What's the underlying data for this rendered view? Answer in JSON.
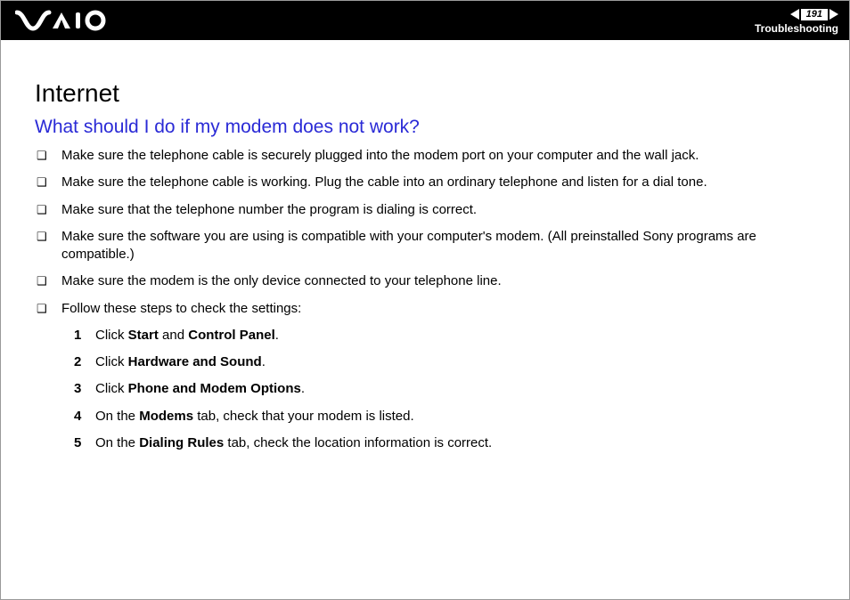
{
  "header": {
    "page_number": "191",
    "section_label": "Troubleshooting"
  },
  "content": {
    "section_title": "Internet",
    "question": "What should I do if my modem does not work?",
    "bullets": [
      "Make sure the telephone cable is securely plugged into the modem port on your computer and the wall jack.",
      "Make sure the telephone cable is working. Plug the cable into an ordinary telephone and listen for a dial tone.",
      "Make sure that the telephone number the program is dialing is correct.",
      "Make sure the software you are using is compatible with your computer's modem. (All preinstalled Sony programs are compatible.)",
      "Make sure the modem is the only device connected to your telephone line.",
      "Follow these steps to check the settings:"
    ],
    "steps": [
      {
        "num": "1",
        "pre": "Click ",
        "bold1": "Start",
        "mid": " and ",
        "bold2": "Control Panel",
        "post": "."
      },
      {
        "num": "2",
        "pre": "Click ",
        "bold1": "Hardware and Sound",
        "mid": "",
        "bold2": "",
        "post": "."
      },
      {
        "num": "3",
        "pre": "Click ",
        "bold1": "Phone and Modem Options",
        "mid": "",
        "bold2": "",
        "post": "."
      },
      {
        "num": "4",
        "pre": "On the ",
        "bold1": "Modems",
        "mid": " tab, check that your modem is listed.",
        "bold2": "",
        "post": ""
      },
      {
        "num": "5",
        "pre": "On the ",
        "bold1": "Dialing Rules",
        "mid": " tab, check the location information is correct.",
        "bold2": "",
        "post": ""
      }
    ]
  }
}
